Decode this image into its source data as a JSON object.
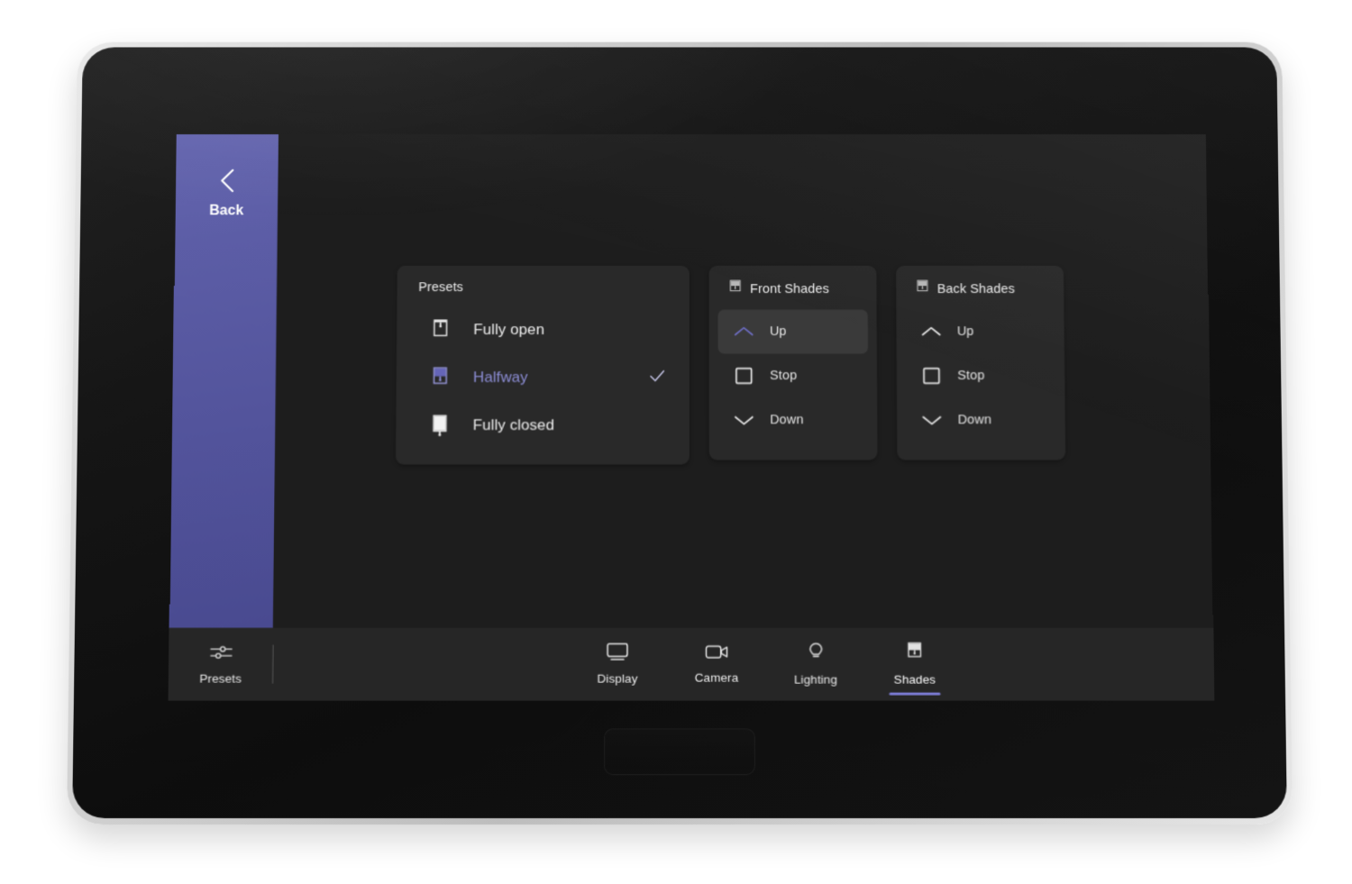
{
  "device": {
    "type": "touch-console",
    "bezel_color": "#c9c9c9",
    "frame_color": "#141414"
  },
  "screen": {
    "background_color": "#1d1d1d",
    "accent_color": "#6f70c4"
  },
  "rail": {
    "label": "Back",
    "icon": "chevron-left-icon",
    "background_color": "#5a5ba2"
  },
  "presets_card": {
    "title": "Presets",
    "items": [
      {
        "label": "Fully open",
        "icon": "shade-fully-open-icon",
        "selected": false,
        "check": ""
      },
      {
        "label": "Halfway",
        "icon": "shade-halfway-icon",
        "selected": true,
        "check": "check-icon"
      },
      {
        "label": "Fully closed",
        "icon": "shade-fully-closed-icon",
        "selected": false,
        "check": ""
      }
    ],
    "selected_color": "#8e8fd8"
  },
  "shade_groups": [
    {
      "title": "Front Shades",
      "icon": "shade-group-icon",
      "buttons": [
        {
          "label": "Up",
          "icon": "chevron-up-icon",
          "active": true
        },
        {
          "label": "Stop",
          "icon": "stop-square-icon",
          "active": false
        },
        {
          "label": "Down",
          "icon": "chevron-down-icon",
          "active": false
        }
      ]
    },
    {
      "title": "Back Shades",
      "icon": "shade-group-icon",
      "buttons": [
        {
          "label": "Up",
          "icon": "chevron-up-icon",
          "active": false
        },
        {
          "label": "Stop",
          "icon": "stop-square-icon",
          "active": false
        },
        {
          "label": "Down",
          "icon": "chevron-down-icon",
          "active": false
        }
      ]
    }
  ],
  "navbar": {
    "presets": {
      "label": "Presets",
      "icon": "sliders-icon"
    },
    "items": [
      {
        "label": "Display",
        "icon": "monitor-icon",
        "active": false
      },
      {
        "label": "Camera",
        "icon": "camera-icon",
        "active": false
      },
      {
        "label": "Lighting",
        "icon": "bulb-icon",
        "active": false
      },
      {
        "label": "Shades",
        "icon": "shade-icon",
        "active": true
      }
    ],
    "active_underline_color": "#7a7ad2"
  }
}
